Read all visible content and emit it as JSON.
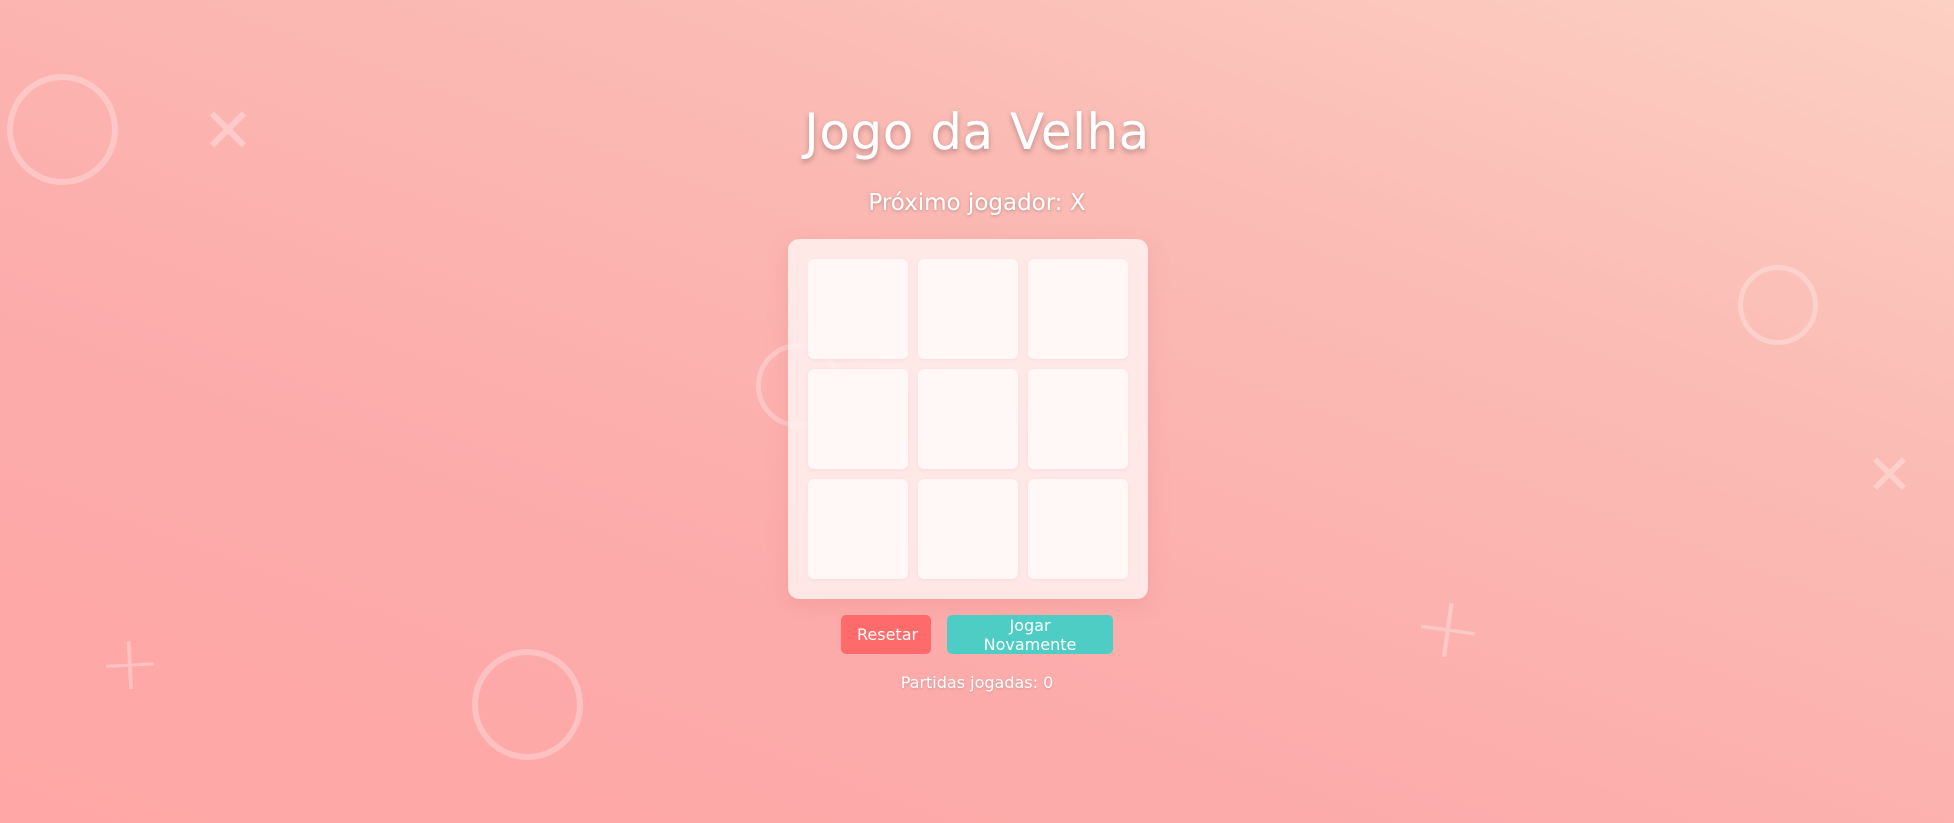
{
  "game": {
    "title": "Jogo da Velha",
    "status": "Próximo jogador: X",
    "board": [
      "",
      "",
      "",
      "",
      "",
      "",
      "",
      "",
      ""
    ],
    "counter": "Partidas jogadas: 0"
  },
  "buttons": {
    "reset_label": "Resetar",
    "play_again_label": "Jogar Novamente"
  },
  "colors": {
    "reset": "#ff6b6b",
    "play_again": "#4ecdc4"
  },
  "decorations": [
    "circle-icon",
    "x-icon",
    "plus-icon"
  ]
}
